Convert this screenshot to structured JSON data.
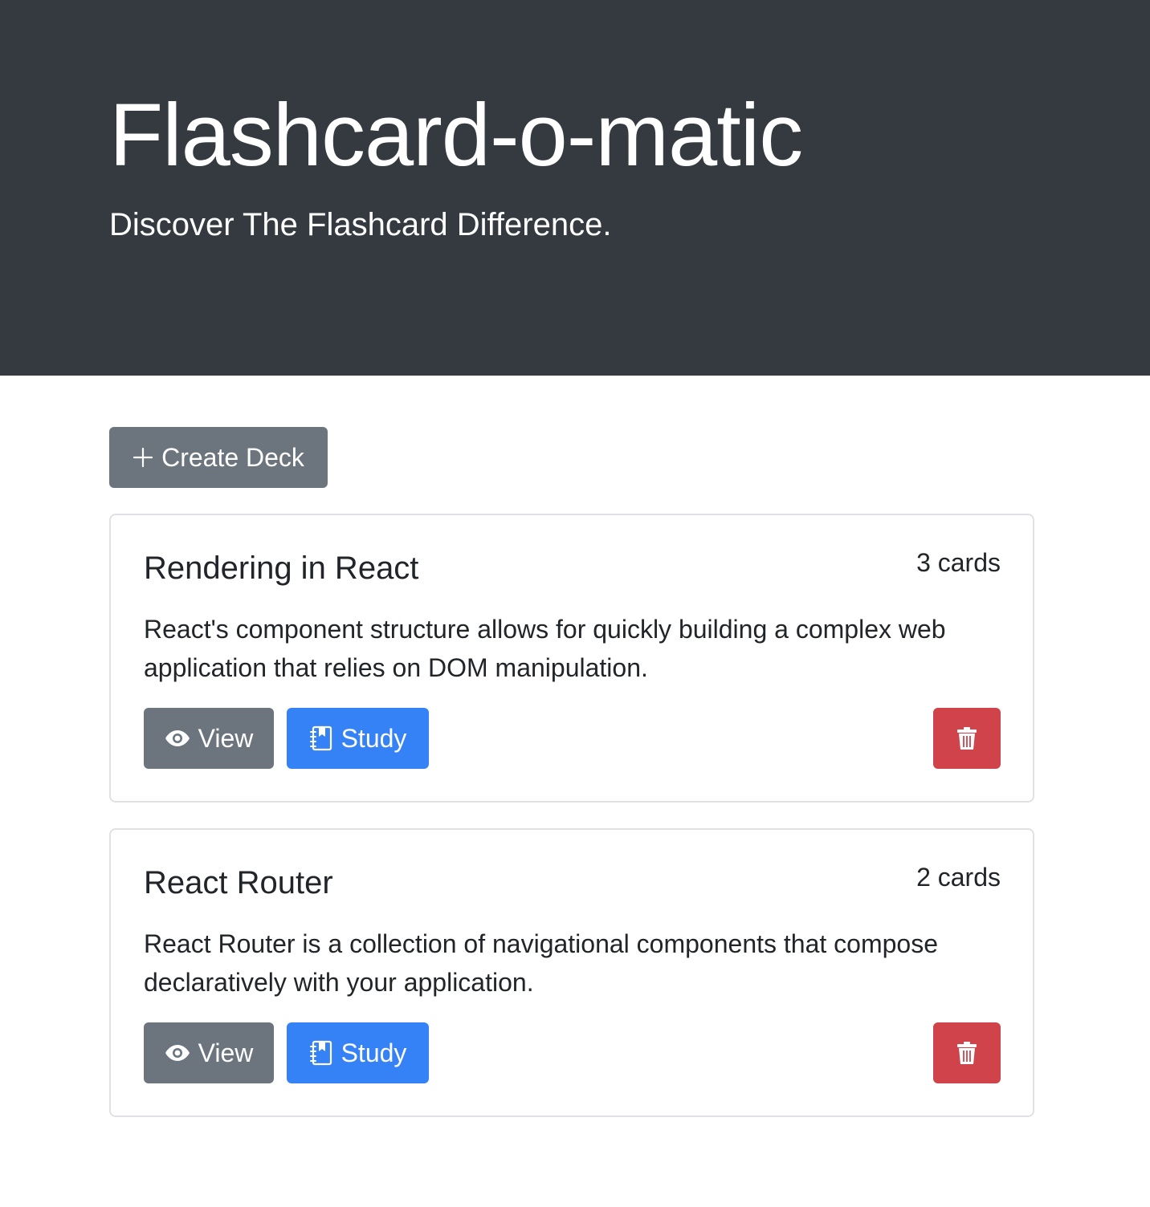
{
  "header": {
    "title": "Flashcard-o-matic",
    "tagline": "Discover The Flashcard Difference."
  },
  "toolbar": {
    "create_label": "Create Deck"
  },
  "colors": {
    "header_bg": "#343a40",
    "secondary": "#6c757d",
    "primary": "#3581f6",
    "danger": "#d0434a"
  },
  "decks": [
    {
      "name": "Rendering in React",
      "count": "3 cards",
      "description": "React's component structure allows for quickly building a complex web application that relies on DOM manipulation.",
      "view_label": "View",
      "study_label": "Study",
      "icons": {
        "view": "eye-icon",
        "study": "journal-bookmark-icon",
        "delete": "trash-icon"
      }
    },
    {
      "name": "React Router",
      "count": "2 cards",
      "description": "React Router is a collection of navigational components that compose declaratively with your application.",
      "view_label": "View",
      "study_label": "Study",
      "icons": {
        "view": "eye-icon",
        "study": "journal-bookmark-icon",
        "delete": "trash-icon"
      }
    }
  ]
}
